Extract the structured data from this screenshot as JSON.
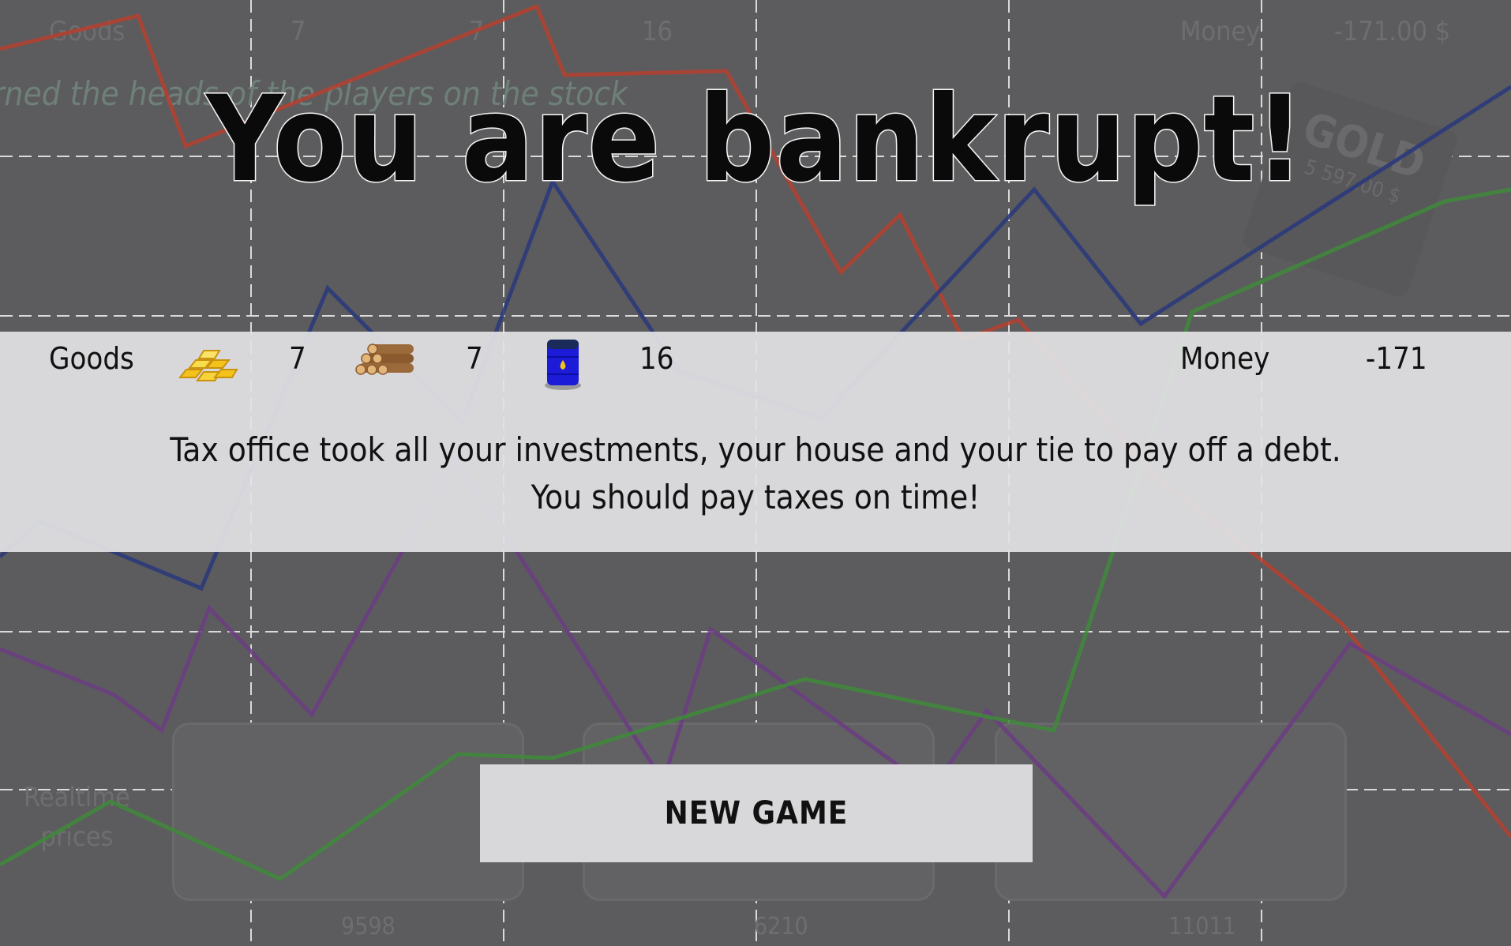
{
  "background": {
    "header_labels": {
      "goods": "Goods",
      "gold_count": "7",
      "wood_count": "7",
      "oil_count": "16",
      "money": "Money",
      "money_value": "-171.00 $"
    },
    "ticker_text": "rned the heads of the players on the stock",
    "realtime_label_line1": "Realtime",
    "realtime_label_line2": "prices",
    "gold_card_label": "GOLD",
    "gold_card_price": "5 597.00 $",
    "price_cards": [
      {
        "resource": "gold",
        "value": "9598"
      },
      {
        "resource": "wood",
        "value": "6210"
      },
      {
        "resource": "oil",
        "value": "11011"
      }
    ],
    "series_colors": {
      "red": "#b5402f",
      "blue": "#2b3a7a",
      "purple": "#6b3c82",
      "green": "#3f8a3a"
    }
  },
  "title": "You are bankrupt!",
  "status_bar": {
    "goods_label": "Goods",
    "gold": {
      "icon": "gold-bars-icon",
      "count": "7"
    },
    "wood": {
      "icon": "wood-logs-icon",
      "count": "7"
    },
    "oil": {
      "icon": "oil-barrel-icon",
      "count": "16"
    },
    "money_label": "Money",
    "money_value": "-171"
  },
  "message": {
    "line1": "Tax office took all your investments, your house and your tie to pay off a debt.",
    "line2": "You should pay taxes on time!"
  },
  "new_game_button": "NEW GAME"
}
